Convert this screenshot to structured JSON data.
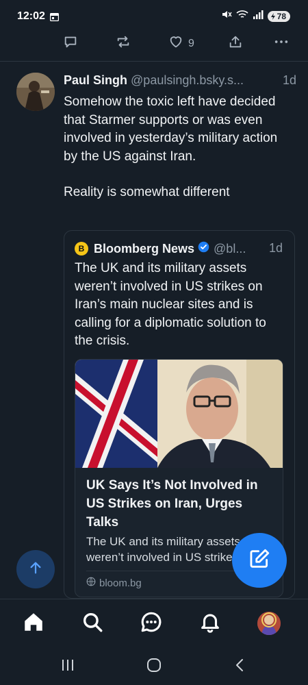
{
  "status_bar": {
    "time": "12:02",
    "battery": "78"
  },
  "top_actions": {
    "like_count": "9"
  },
  "post": {
    "author_name": "Paul Singh",
    "author_handle": "@paulsingh.bsky.s...",
    "time_ago": "1d",
    "text_line1": "Somehow the toxic left have decided that Starmer supports or was even involved in yesterday’s military action by the US against Iran.",
    "text_line2": "Reality is somewhat different"
  },
  "quote": {
    "logo_letter": "B",
    "author_name": "Bloomberg News",
    "author_handle": "@bl...",
    "time_ago": "1d",
    "text": "The UK and its military assets weren’t involved in US strikes on Iran’s main nuclear sites and is calling for a diplomatic solution to the crisis."
  },
  "link_card": {
    "title": "UK Says It’s Not Involved in US Strikes on Iran, Urges Talks",
    "description": "The UK and its military assets weren’t involved in US strikes",
    "domain": "bloom.bg"
  },
  "icons": {
    "reply": "reply-icon",
    "repost": "repost-icon",
    "like": "heart-icon",
    "share": "share-icon",
    "more": "more-icon",
    "verified": "verified-badge-icon",
    "globe": "globe-icon",
    "scroll_top": "arrow-up-icon",
    "compose": "compose-icon",
    "home": "home-icon",
    "search": "search-icon",
    "chat": "chat-icon",
    "notifications": "bell-icon"
  },
  "colors": {
    "background": "#161e27",
    "accent": "#1f7ef3",
    "muted_text": "#8c98a4",
    "border": "#2c3640",
    "brand_yellow": "#f5c518"
  }
}
